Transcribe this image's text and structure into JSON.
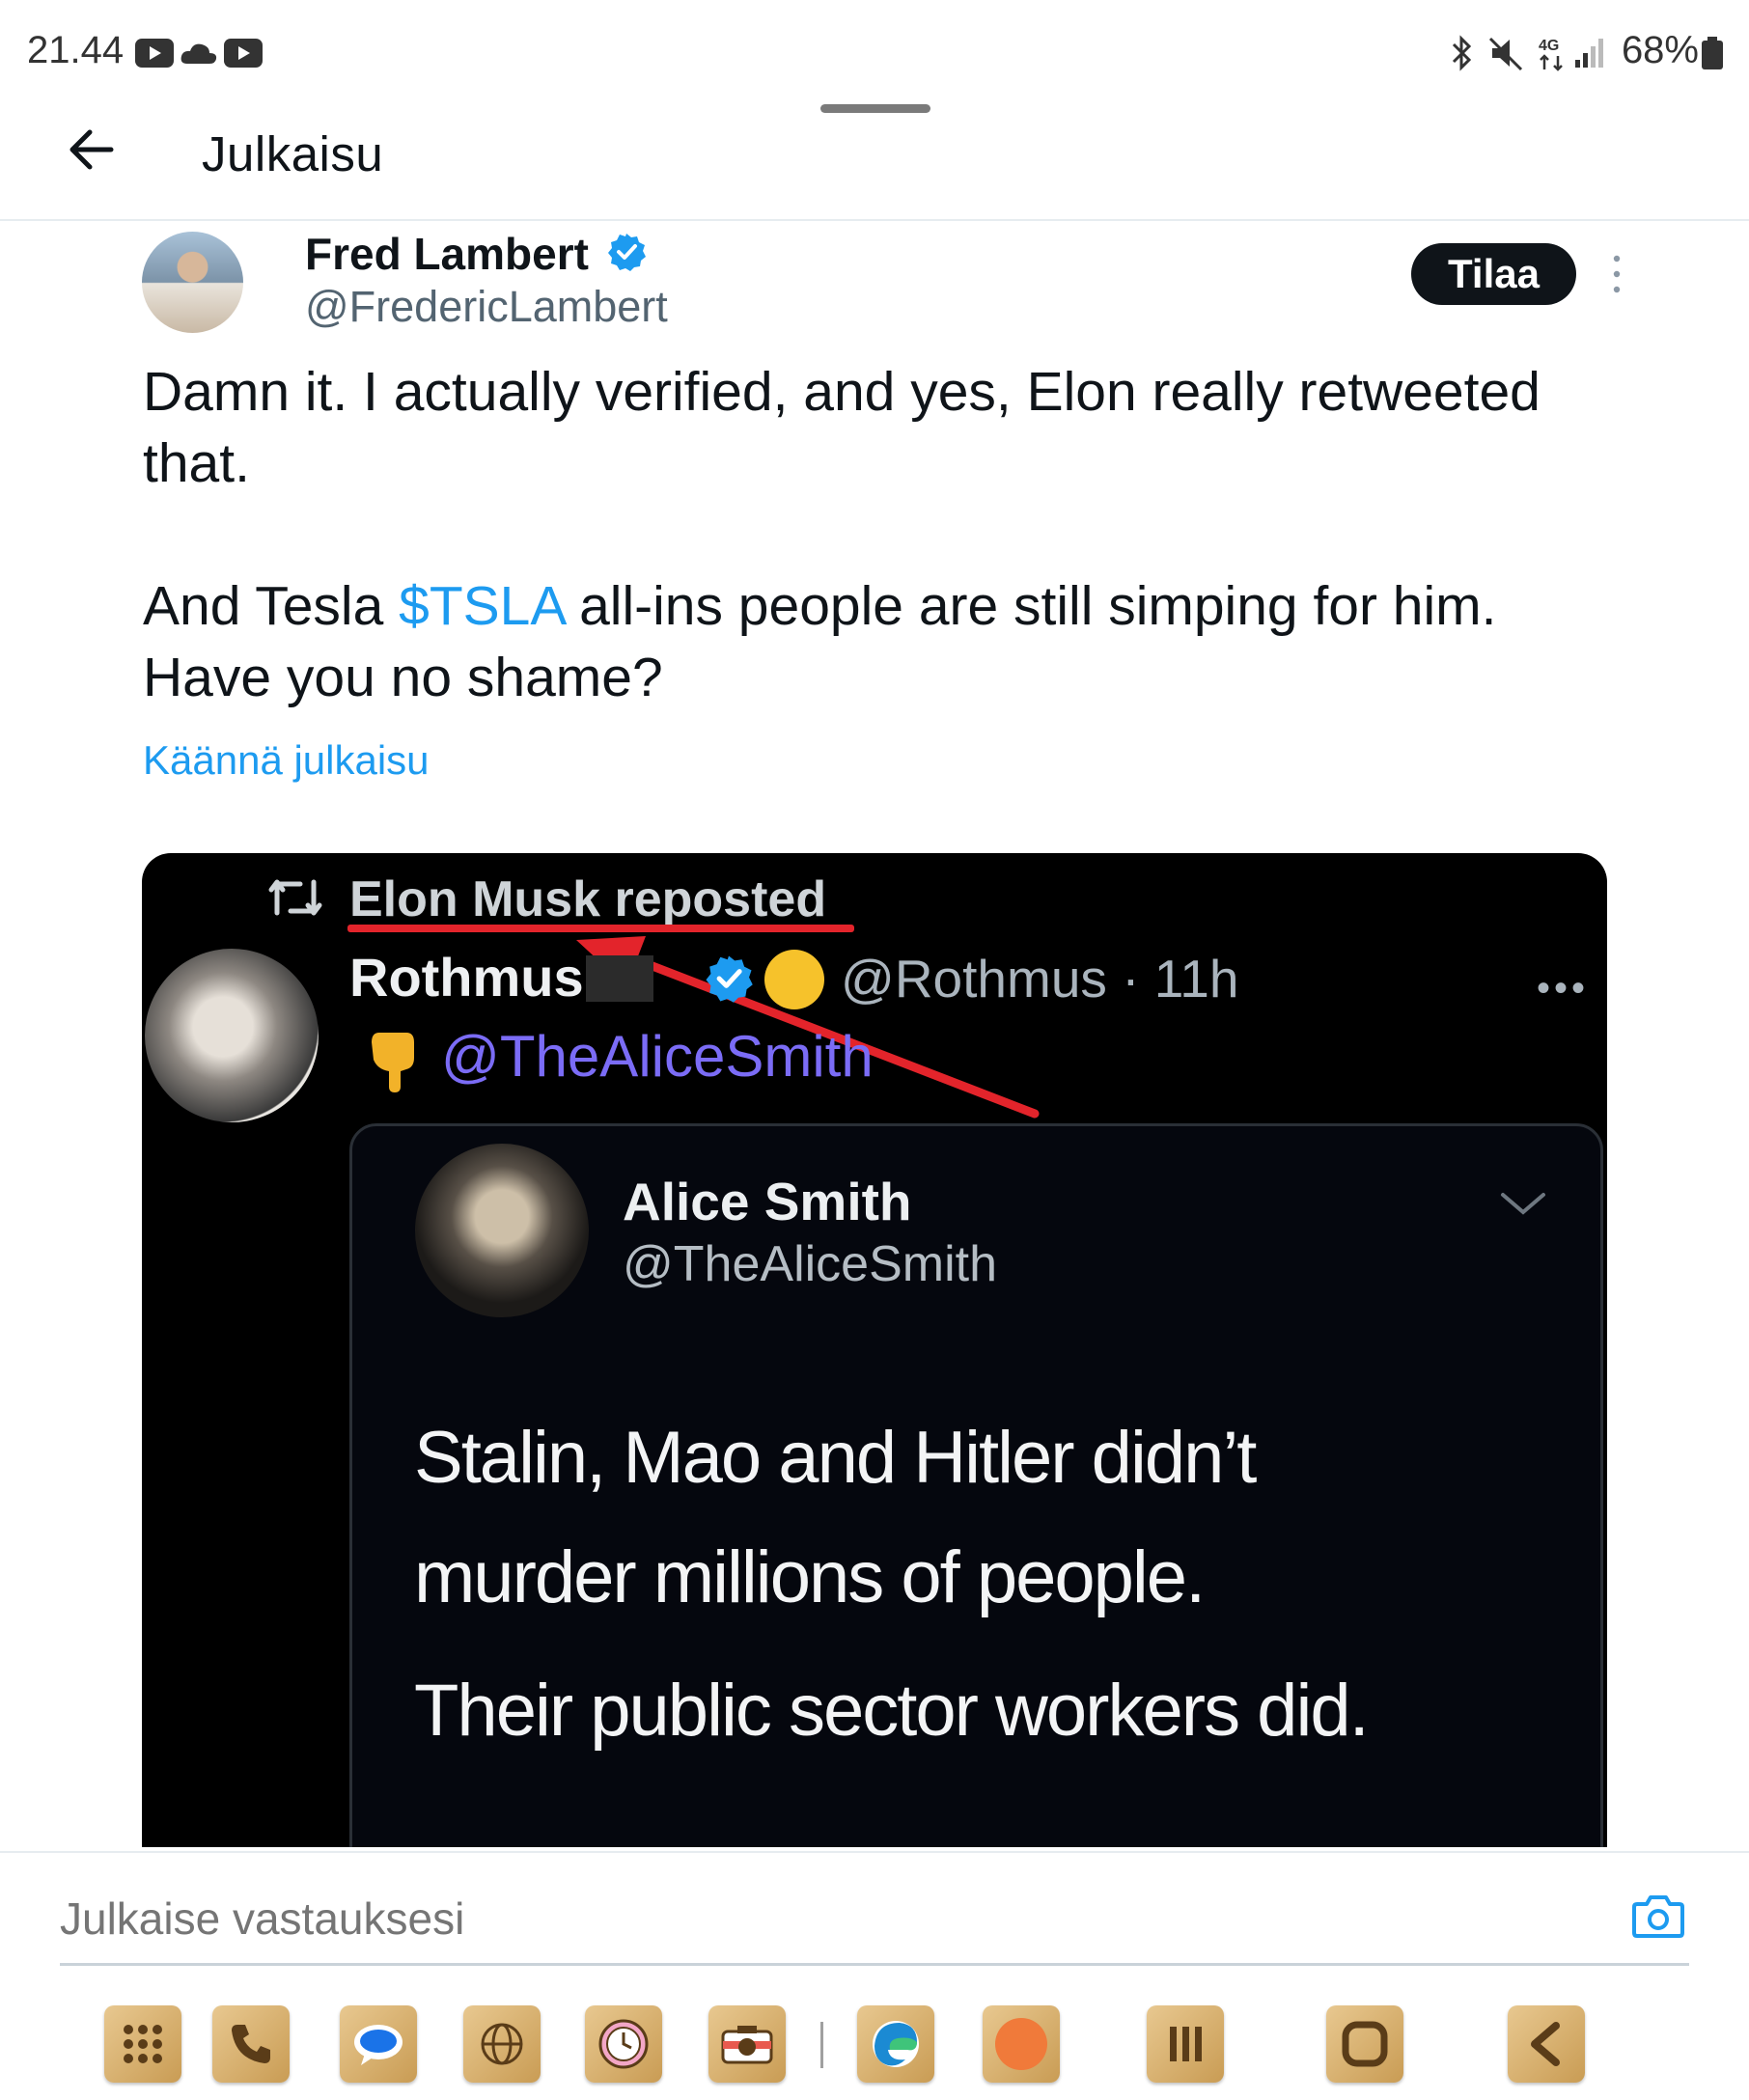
{
  "status_bar": {
    "time": "21.44",
    "battery": "68%",
    "network": "4G"
  },
  "header": {
    "title": "Julkaisu"
  },
  "post": {
    "author_name": "Fred Lambert",
    "author_handle": "@FredericLambert",
    "subscribe_label": "Tilaa",
    "text_line1": "Damn it. I actually verified, and yes, Elon really retweeted",
    "text_line2": "that.",
    "text_line3_before": "And Tesla ",
    "text_line3_cashtag": "$TSLA",
    "text_line3_after": " all-ins people are still simping for him.",
    "text_line4": "Have you no shame?",
    "translate_label": "Käännä julkaisu"
  },
  "media": {
    "repost_text": "Elon Musk reposted",
    "rothmus_name": "Rothmus",
    "rothmus_handle_time": "@Rothmus · 11h",
    "rothmus_more": "•••",
    "mention": "@TheAliceSmith",
    "quote": {
      "name": "Alice Smith",
      "handle": "@TheAliceSmith",
      "line1": "Stalin, Mao and Hitler didn’t",
      "line2": "murder millions of people.",
      "line3": "Their public sector workers did."
    },
    "annotation_color": "#e3242b"
  },
  "reply": {
    "placeholder": "Julkaise vastauksesi"
  },
  "dock": {
    "icons": [
      "apps-grid-icon",
      "phone-icon",
      "messages-icon",
      "browser-globe-icon",
      "clock-icon",
      "camera-app-icon",
      "edge-browser-icon",
      "orange-app-icon",
      "recents-icon",
      "home-icon",
      "back-nav-icon"
    ]
  },
  "colors": {
    "accent": "#1d9bf0",
    "text": "#0f1419",
    "secondary": "#536471"
  }
}
